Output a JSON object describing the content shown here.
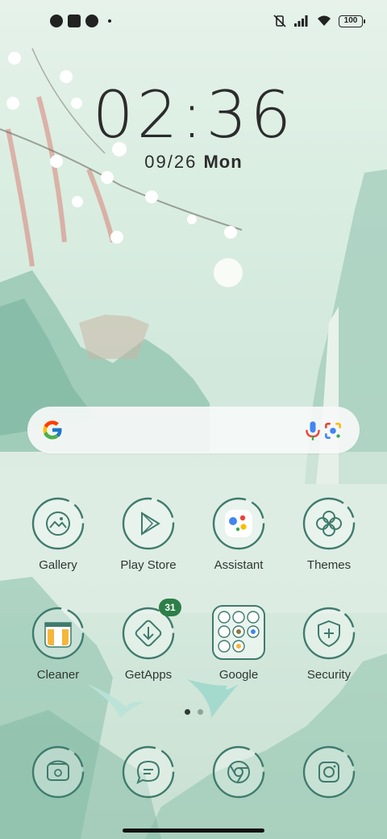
{
  "status_bar": {
    "battery": "100"
  },
  "lockscreen": {
    "time": "02:36",
    "date": "09/26",
    "weekday": "Mon"
  },
  "search": {
    "engine_icon": "google-g-icon",
    "mic_icon": "mic-icon",
    "lens_icon": "lens-camera-icon"
  },
  "apps_row1": [
    {
      "label": "Gallery",
      "icon": "gallery-icon"
    },
    {
      "label": "Play Store",
      "icon": "play-store-icon"
    },
    {
      "label": "Assistant",
      "icon": "assistant-icon"
    },
    {
      "label": "Themes",
      "icon": "themes-icon"
    }
  ],
  "apps_row2": [
    {
      "label": "Cleaner",
      "icon": "cleaner-icon"
    },
    {
      "label": "GetApps",
      "icon": "getapps-icon",
      "badge": "31"
    },
    {
      "label": "Google",
      "icon": "google-folder-icon"
    },
    {
      "label": "Security",
      "icon": "security-icon"
    }
  ],
  "dock": [
    {
      "icon": "phone-icon"
    },
    {
      "icon": "messages-icon"
    },
    {
      "icon": "chrome-icon"
    },
    {
      "icon": "camera-icon"
    }
  ],
  "page_indicator": {
    "current": 1,
    "total": 2
  },
  "colors": {
    "icon_stroke": "#3f7b6d",
    "badge": "#2d7f47",
    "wallpaper_base": "#d6eadf"
  }
}
